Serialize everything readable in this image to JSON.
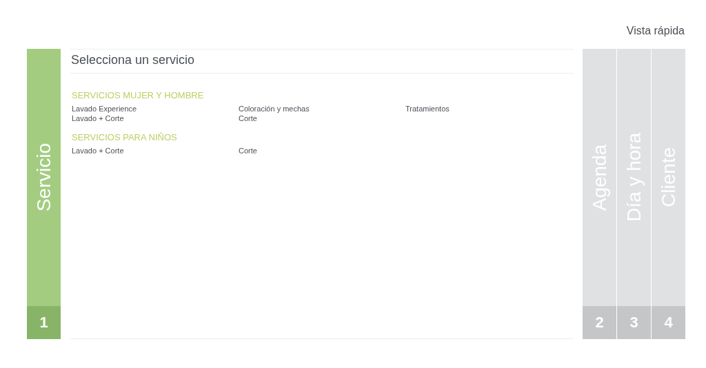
{
  "quick_view_link": "Vista rápida",
  "steps": [
    {
      "label": "Servicio",
      "number": "1",
      "selected": true
    },
    {
      "label": "Agenda",
      "number": "2",
      "selected": false
    },
    {
      "label": "Día y hora",
      "number": "3",
      "selected": false
    },
    {
      "label": "Cliente",
      "number": "4",
      "selected": false
    }
  ],
  "panel": {
    "title": "Selecciona un servicio",
    "groups": [
      {
        "heading": "SERVICIOS MUJER Y HOMBRE",
        "columns": [
          [
            "Lavado Experience",
            "Lavado + Corte"
          ],
          [
            "Coloración y mechas",
            "Corte"
          ],
          [
            "Tratamientos"
          ]
        ]
      },
      {
        "heading": "SERVICIOS PARA NIÑOS",
        "columns": [
          [
            "Lavado + Corte"
          ],
          [
            "Corte"
          ]
        ]
      }
    ]
  }
}
